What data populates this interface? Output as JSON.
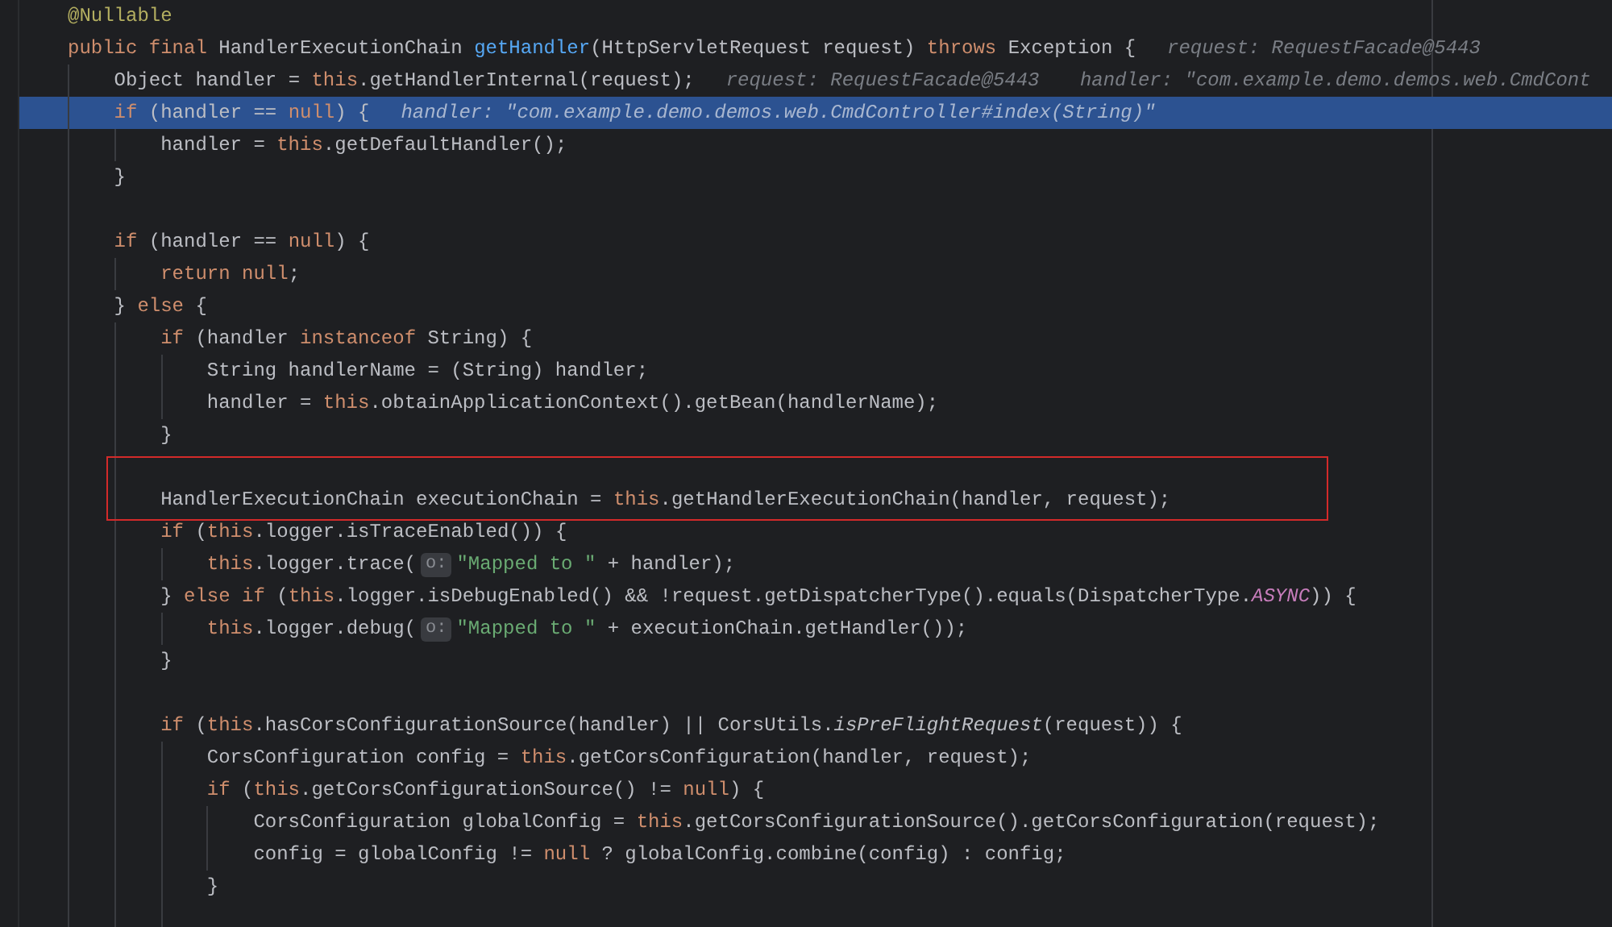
{
  "lines": [
    {
      "selected": false,
      "segments": [
        {
          "kind": "code",
          "tokens": [
            {
              "kind": "annotation",
              "text": "@Nullable"
            }
          ]
        }
      ]
    },
    {
      "selected": false,
      "segments": [
        {
          "kind": "code",
          "tokens": [
            {
              "kind": "keyword",
              "text": "public final "
            },
            {
              "kind": "plain",
              "text": "HandlerExecutionChain "
            },
            {
              "kind": "method",
              "text": "getHandler"
            },
            {
              "kind": "plain",
              "text": "(HttpServletRequest request) "
            },
            {
              "kind": "keyword",
              "text": "throws "
            },
            {
              "kind": "plain",
              "text": "Exception {"
            }
          ]
        },
        {
          "kind": "debug",
          "text": "request: RequestFacade@5443"
        }
      ],
      "children": [
        {
          "selected": false,
          "segments": [
            {
              "kind": "code",
              "tokens": [
                {
                  "kind": "plain",
                  "text": "Object handler = "
                },
                {
                  "kind": "keyword",
                  "text": "this"
                },
                {
                  "kind": "plain",
                  "text": ".getHandlerInternal(request);"
                }
              ]
            },
            {
              "kind": "debug",
              "text": "request: RequestFacade@5443"
            },
            {
              "kind": "debug",
              "text": "handler: \"com.example.demo.demos.web.CmdCont"
            }
          ]
        },
        {
          "selected": true,
          "segments": [
            {
              "kind": "code",
              "tokens": [
                {
                  "kind": "keyword",
                  "text": "if "
                },
                {
                  "kind": "plain",
                  "text": "(handler == "
                },
                {
                  "kind": "keyword",
                  "text": "null"
                },
                {
                  "kind": "plain",
                  "text": ") {"
                }
              ]
            },
            {
              "kind": "debug",
              "text": "handler: \"com.example.demo.demos.web.CmdController#index(String)\""
            }
          ],
          "children": [
            {
              "selected": false,
              "segments": [
                {
                  "kind": "code",
                  "tokens": [
                    {
                      "kind": "plain",
                      "text": "handler = "
                    },
                    {
                      "kind": "keyword",
                      "text": "this"
                    },
                    {
                      "kind": "plain",
                      "text": ".getDefaultHandler();"
                    }
                  ]
                }
              ]
            }
          ]
        },
        {
          "selected": false,
          "segments": [
            {
              "kind": "code",
              "tokens": [
                {
                  "kind": "plain",
                  "text": "}"
                }
              ]
            }
          ]
        },
        {
          "selected": false
        },
        {
          "selected": false,
          "segments": [
            {
              "kind": "code",
              "tokens": [
                {
                  "kind": "keyword",
                  "text": "if "
                },
                {
                  "kind": "plain",
                  "text": "(handler == "
                },
                {
                  "kind": "keyword",
                  "text": "null"
                },
                {
                  "kind": "plain",
                  "text": ") {"
                }
              ]
            }
          ],
          "children": [
            {
              "selected": false,
              "segments": [
                {
                  "kind": "code",
                  "tokens": [
                    {
                      "kind": "keyword",
                      "text": "return null"
                    },
                    {
                      "kind": "plain",
                      "text": ";"
                    }
                  ]
                }
              ]
            }
          ]
        },
        {
          "selected": false,
          "segments": [
            {
              "kind": "code",
              "tokens": [
                {
                  "kind": "plain",
                  "text": "} "
                },
                {
                  "kind": "keyword",
                  "text": "else "
                },
                {
                  "kind": "plain",
                  "text": "{"
                }
              ]
            }
          ],
          "children": [
            {
              "selected": false,
              "segments": [
                {
                  "kind": "code",
                  "tokens": [
                    {
                      "kind": "keyword",
                      "text": "if "
                    },
                    {
                      "kind": "plain",
                      "text": "(handler "
                    },
                    {
                      "kind": "keyword",
                      "text": "instanceof "
                    },
                    {
                      "kind": "plain",
                      "text": "String) {"
                    }
                  ]
                }
              ],
              "children": [
                {
                  "selected": false,
                  "segments": [
                    {
                      "kind": "code",
                      "tokens": [
                        {
                          "kind": "plain",
                          "text": "String handlerName = (String) handler;"
                        }
                      ]
                    }
                  ]
                },
                {
                  "selected": false,
                  "segments": [
                    {
                      "kind": "code",
                      "tokens": [
                        {
                          "kind": "plain",
                          "text": "handler = "
                        },
                        {
                          "kind": "keyword",
                          "text": "this"
                        },
                        {
                          "kind": "plain",
                          "text": ".obtainApplicationContext().getBean(handlerName);"
                        }
                      ]
                    }
                  ]
                }
              ]
            },
            {
              "selected": false,
              "segments": [
                {
                  "kind": "code",
                  "tokens": [
                    {
                      "kind": "plain",
                      "text": "}"
                    }
                  ]
                }
              ]
            },
            {
              "selected": false
            },
            {
              "selected": false,
              "segments": [
                {
                  "kind": "code",
                  "tokens": [
                    {
                      "kind": "plain",
                      "text": "HandlerExecutionChain executionChain = "
                    },
                    {
                      "kind": "keyword",
                      "text": "this"
                    },
                    {
                      "kind": "plain",
                      "text": ".getHandlerExecutionChain(handler, request);"
                    }
                  ]
                }
              ]
            },
            {
              "selected": false,
              "segments": [
                {
                  "kind": "code",
                  "tokens": [
                    {
                      "kind": "keyword",
                      "text": "if "
                    },
                    {
                      "kind": "plain",
                      "text": "("
                    },
                    {
                      "kind": "keyword",
                      "text": "this"
                    },
                    {
                      "kind": "plain",
                      "text": ".logger.isTraceEnabled()) {"
                    }
                  ]
                }
              ],
              "children": [
                {
                  "selected": false,
                  "segments": [
                    {
                      "kind": "code",
                      "tokens": [
                        {
                          "kind": "keyword",
                          "text": "this"
                        },
                        {
                          "kind": "plain",
                          "text": ".logger.trace("
                        }
                      ]
                    },
                    {
                      "kind": "hint",
                      "text": "o:"
                    },
                    {
                      "kind": "code",
                      "tokens": [
                        {
                          "kind": "string",
                          "text": "\"Mapped to \""
                        },
                        {
                          "kind": "plain",
                          "text": " + handler);"
                        }
                      ]
                    }
                  ]
                }
              ]
            },
            {
              "selected": false,
              "segments": [
                {
                  "kind": "code",
                  "tokens": [
                    {
                      "kind": "plain",
                      "text": "} "
                    },
                    {
                      "kind": "keyword",
                      "text": "else if "
                    },
                    {
                      "kind": "plain",
                      "text": "("
                    },
                    {
                      "kind": "keyword",
                      "text": "this"
                    },
                    {
                      "kind": "plain",
                      "text": ".logger.isDebugEnabled() && !request.getDispatcherType().equals(DispatcherType."
                    },
                    {
                      "kind": "constant",
                      "text": "ASYNC"
                    },
                    {
                      "kind": "plain",
                      "text": ")) {"
                    }
                  ]
                }
              ],
              "children": [
                {
                  "selected": false,
                  "segments": [
                    {
                      "kind": "code",
                      "tokens": [
                        {
                          "kind": "keyword",
                          "text": "this"
                        },
                        {
                          "kind": "plain",
                          "text": ".logger.debug("
                        }
                      ]
                    },
                    {
                      "kind": "hint",
                      "text": "o:"
                    },
                    {
                      "kind": "code",
                      "tokens": [
                        {
                          "kind": "string",
                          "text": "\"Mapped to \""
                        },
                        {
                          "kind": "plain",
                          "text": " + executionChain.getHandler());"
                        }
                      ]
                    }
                  ]
                }
              ]
            },
            {
              "selected": false,
              "segments": [
                {
                  "kind": "code",
                  "tokens": [
                    {
                      "kind": "plain",
                      "text": "}"
                    }
                  ]
                }
              ]
            },
            {
              "selected": false
            },
            {
              "selected": false,
              "segments": [
                {
                  "kind": "code",
                  "tokens": [
                    {
                      "kind": "keyword",
                      "text": "if "
                    },
                    {
                      "kind": "plain",
                      "text": "("
                    },
                    {
                      "kind": "keyword",
                      "text": "this"
                    },
                    {
                      "kind": "plain",
                      "text": ".hasCorsConfigurationSource(handler) || CorsUtils."
                    },
                    {
                      "kind": "static",
                      "text": "isPreFlightRequest"
                    },
                    {
                      "kind": "plain",
                      "text": "(request)) {"
                    }
                  ]
                }
              ],
              "children": [
                {
                  "selected": false,
                  "segments": [
                    {
                      "kind": "code",
                      "tokens": [
                        {
                          "kind": "plain",
                          "text": "CorsConfiguration config = "
                        },
                        {
                          "kind": "keyword",
                          "text": "this"
                        },
                        {
                          "kind": "plain",
                          "text": ".getCorsConfiguration(handler, request);"
                        }
                      ]
                    }
                  ]
                },
                {
                  "selected": false,
                  "segments": [
                    {
                      "kind": "code",
                      "tokens": [
                        {
                          "kind": "keyword",
                          "text": "if "
                        },
                        {
                          "kind": "plain",
                          "text": "("
                        },
                        {
                          "kind": "keyword",
                          "text": "this"
                        },
                        {
                          "kind": "plain",
                          "text": ".getCorsConfigurationSource() != "
                        },
                        {
                          "kind": "keyword",
                          "text": "null"
                        },
                        {
                          "kind": "plain",
                          "text": ") {"
                        }
                      ]
                    }
                  ],
                  "children": [
                    {
                      "selected": false,
                      "segments": [
                        {
                          "kind": "code",
                          "tokens": [
                            {
                              "kind": "plain",
                              "text": "CorsConfiguration globalConfig = "
                            },
                            {
                              "kind": "keyword",
                              "text": "this"
                            },
                            {
                              "kind": "plain",
                              "text": ".getCorsConfigurationSource().getCorsConfiguration(request);"
                            }
                          ]
                        }
                      ]
                    },
                    {
                      "selected": false,
                      "segments": [
                        {
                          "kind": "code",
                          "tokens": [
                            {
                              "kind": "plain",
                              "text": "config = globalConfig != "
                            },
                            {
                              "kind": "keyword",
                              "text": "null"
                            },
                            {
                              "kind": "plain",
                              "text": " ? globalConfig.combine(config) : config;"
                            }
                          ]
                        }
                      ]
                    }
                  ]
                },
                {
                  "selected": false,
                  "segments": [
                    {
                      "kind": "code",
                      "tokens": [
                        {
                          "kind": "plain",
                          "text": "}"
                        }
                      ]
                    }
                  ]
                },
                {
                  "selected": false
                }
              ]
            }
          ]
        }
      ]
    }
  ]
}
